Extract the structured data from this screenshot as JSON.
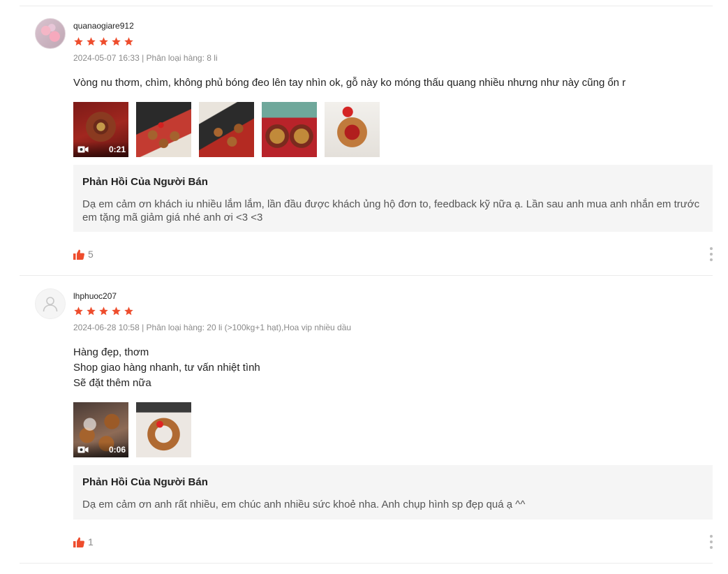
{
  "reviews": [
    {
      "username": "quanaogiare912",
      "rating": 5,
      "meta": "2024-05-07 16:33 | Phân loại hàng: 8 li",
      "content_lines": [
        "Vòng nu thơm, chìm, không phủ bóng đeo lên tay nhìn ok, gỗ này ko móng thấu quang nhiều nhưng như này cũng ổn r"
      ],
      "video_duration": "0:21",
      "reply_title": "Phản Hồi Của Người Bán",
      "reply_text": "Dạ em cảm ơn khách iu nhiều lắm lắm, lần đầu được khách ủng hộ đơn to, feedback kỹ nữa ạ. Lần sau anh mua anh nhắn em trước em tặng mã giảm giá nhé anh ơi <3 <3",
      "likes": "5"
    },
    {
      "username": "lhphuoc207",
      "rating": 5,
      "meta": "2024-06-28 10:58 | Phân loại hàng: 20 li (>100kg+1 hạt),Hoa vip nhiều dầu",
      "content_lines": [
        "Hàng đẹp, thơm",
        "Shop giao hàng nhanh, tư vấn nhiệt tình",
        "Sẽ đặt thêm nữa"
      ],
      "video_duration": "0:06",
      "reply_title": "Phản Hồi Của Người Bán",
      "reply_text": "Dạ em cảm ơn anh rất nhiều, em chúc anh nhiều sức khoẻ nha. Anh chụp hình sp đẹp quá ạ ^^",
      "likes": "1"
    }
  ],
  "colors": {
    "star": "#ee4d2d",
    "like": "#ee4d2d",
    "reply_bg": "#f5f5f5"
  },
  "icons": {
    "rating": "star-icon",
    "like": "thumbs-up-icon",
    "video": "video-camera-icon",
    "more": "more-vertical-icon",
    "default_avatar": "user-icon"
  }
}
